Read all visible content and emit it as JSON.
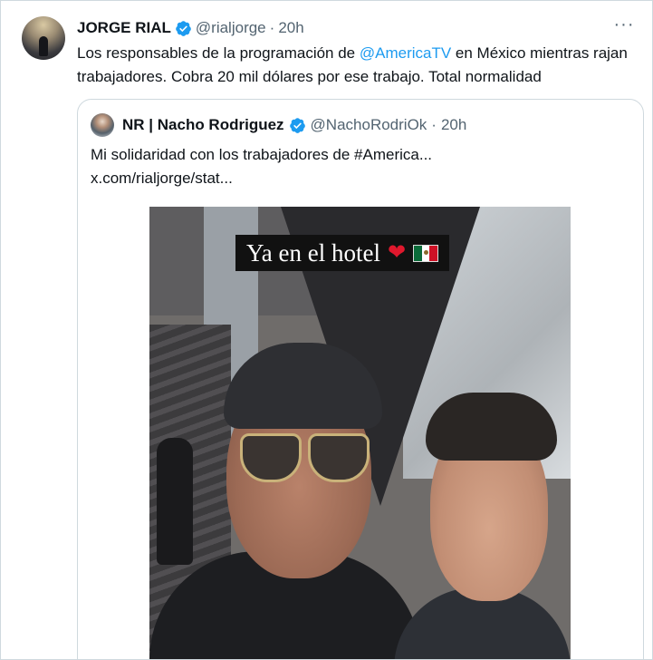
{
  "tweet": {
    "author_name": "JORGE RIAL",
    "handle": "@rialjorge",
    "separator": "·",
    "time": "20h",
    "more": "···",
    "text_before": "Los responsables de la programación de ",
    "mention": "@AmericaTV",
    "text_after": " en México mientras rajan trabajadores. Cobra 20 mil dólares por ese trabajo. Total normalidad"
  },
  "quote": {
    "author_name": "NR | Nacho Rodriguez",
    "handle": "@NachoRodriOk",
    "separator": "·",
    "time": "20h",
    "text_line1": "Mi solidaridad con los trabajadores de #America...",
    "text_line2": "x.com/rialjorge/stat...",
    "image_caption": "Ya en el hotel"
  },
  "colors": {
    "accent": "#1d9bf0",
    "secondary_text": "#536471",
    "border": "#cfd9de"
  },
  "icons": {
    "verified": "verified-badge-icon",
    "more": "more-options-icon",
    "heart": "red-heart-emoji",
    "flag": "mexico-flag-emoji"
  }
}
